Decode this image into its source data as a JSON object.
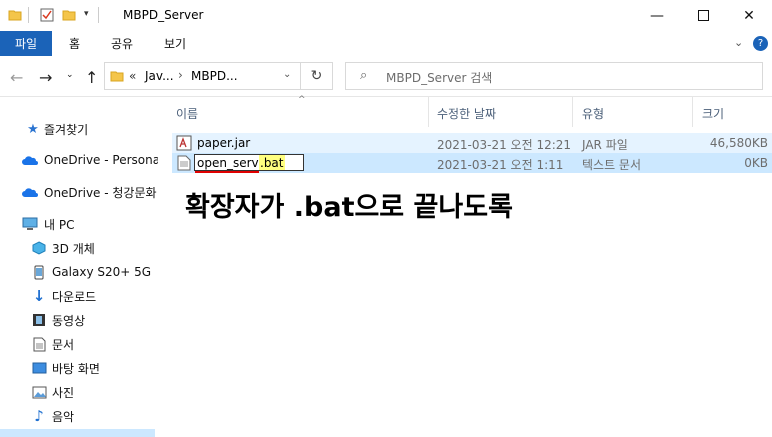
{
  "window": {
    "title": "MBPD_Server",
    "minimize_icon": "minimize-icon",
    "maximize_icon": "maximize-icon",
    "close_icon": "close-icon"
  },
  "ribbon": {
    "tabs": [
      {
        "label": "파일"
      },
      {
        "label": "홈"
      },
      {
        "label": "공유"
      },
      {
        "label": "보기"
      }
    ],
    "help_glyph": "?"
  },
  "address_bar": {
    "prefix": "«",
    "crumbs": [
      "Jav...",
      "MBPD..."
    ],
    "separator": "›"
  },
  "search": {
    "placeholder": "MBPD_Server 검색"
  },
  "nav_pane": {
    "items": [
      {
        "label": "즐겨찾기",
        "icon": "star-icon"
      },
      {
        "label": "OneDrive - Personal",
        "icon": "cloud-icon"
      },
      {
        "label": "OneDrive - 청강문화",
        "icon": "cloud-icon"
      },
      {
        "label": "내 PC",
        "icon": "pc-icon"
      },
      {
        "label": "3D 개체",
        "icon": "cube-icon"
      },
      {
        "label": "Galaxy S20+ 5G",
        "icon": "phone-icon"
      },
      {
        "label": "다운로드",
        "icon": "download-icon"
      },
      {
        "label": "동영상",
        "icon": "video-icon"
      },
      {
        "label": "문서",
        "icon": "document-icon"
      },
      {
        "label": "바탕 화면",
        "icon": "desktop-icon"
      },
      {
        "label": "사진",
        "icon": "picture-icon"
      },
      {
        "label": "음악",
        "icon": "music-icon"
      }
    ]
  },
  "file_list": {
    "columns": {
      "name": "이름",
      "modified": "수정한 날짜",
      "type": "유형",
      "size": "크기"
    },
    "rows": [
      {
        "name": "paper.jar",
        "modified": "2021-03-21 오전 12:21",
        "type": "JAR 파일",
        "size": "46,580KB",
        "icon": "jar-file-icon"
      },
      {
        "name_base": "open_server",
        "name_ext": ".bat",
        "modified": "2021-03-21 오전 1:11",
        "type": "텍스트 문서",
        "size": "0KB",
        "icon": "text-file-icon"
      }
    ]
  },
  "annotation": {
    "text": "확장자가 .bat으로 끝나도록",
    "underline_color": "#e00000"
  },
  "colors": {
    "accent": "#1b63b8",
    "selected_row": "#cce8ff",
    "hover_row": "#e5f3ff",
    "ext_highlight": "#ffff80"
  }
}
